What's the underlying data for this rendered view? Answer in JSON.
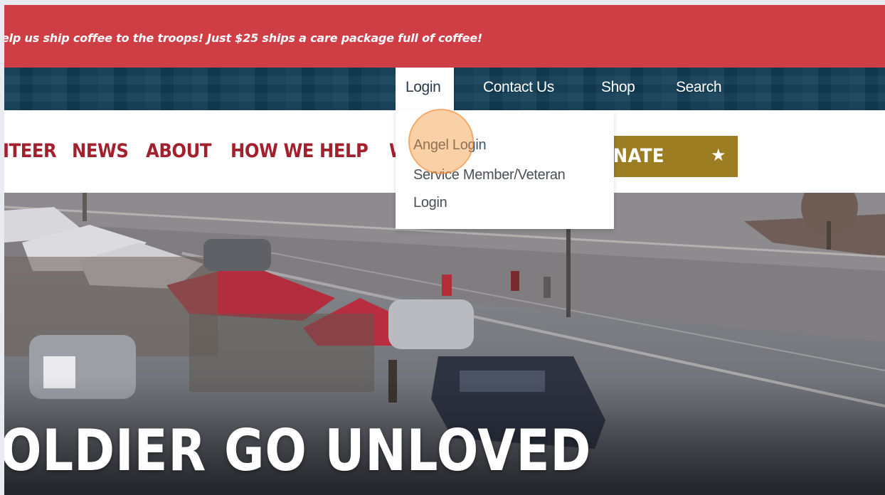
{
  "banner": {
    "text": "elp us ship coffee to the troops! Just $25 ships a care package full of coffee!",
    "bg_color": "#cf3e45"
  },
  "utility_nav": {
    "items": [
      {
        "label": "Login",
        "active": true
      },
      {
        "label": "Contact Us"
      },
      {
        "label": "Shop"
      },
      {
        "label": "Search"
      }
    ],
    "bg_color": "#123d55"
  },
  "main_nav": {
    "items": [
      {
        "label": "ITEER"
      },
      {
        "label": "NEWS"
      },
      {
        "label": "ABOUT"
      },
      {
        "label": "HOW WE HELP"
      },
      {
        "label": "W"
      }
    ],
    "donate_label": "DONATE",
    "donate_icon": "star-icon",
    "text_color": "#a3212f",
    "donate_color": "#9c7d22"
  },
  "login_dropdown": {
    "items": [
      {
        "label": "Angel Login"
      },
      {
        "label": "Service Member/Veteran"
      },
      {
        "label": "Login"
      }
    ]
  },
  "hero": {
    "headline": "OLDIER GO UNLOVED"
  }
}
